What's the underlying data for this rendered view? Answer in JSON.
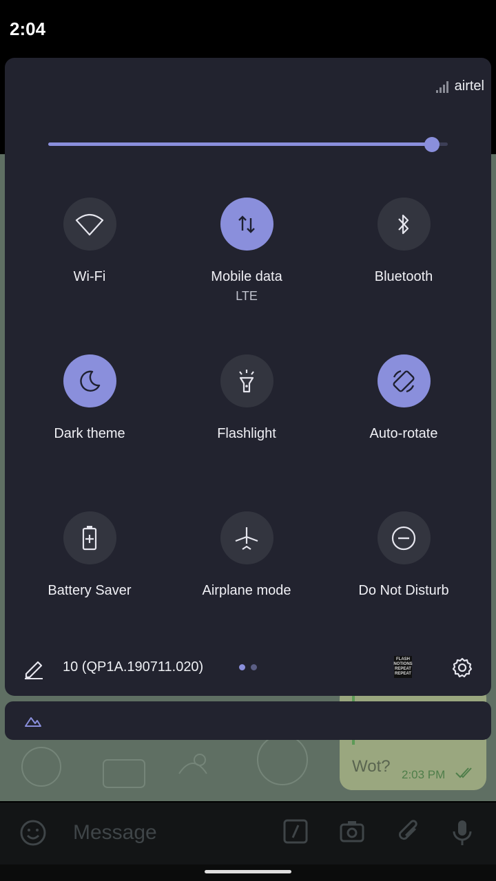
{
  "status_bar": {
    "time": "2:04"
  },
  "quick_settings": {
    "carrier": "airtel",
    "brightness": 0.96,
    "tiles": [
      {
        "label": "Wi-Fi",
        "sub": "",
        "active": false,
        "icon": "wifi-icon"
      },
      {
        "label": "Mobile data",
        "sub": "LTE",
        "active": true,
        "icon": "mobile-data-icon"
      },
      {
        "label": "Bluetooth",
        "sub": "",
        "active": false,
        "icon": "bluetooth-icon"
      },
      {
        "label": "Dark theme",
        "sub": "",
        "active": true,
        "icon": "moon-icon"
      },
      {
        "label": "Flashlight",
        "sub": "",
        "active": false,
        "icon": "flashlight-icon"
      },
      {
        "label": "Auto-rotate",
        "sub": "",
        "active": true,
        "icon": "rotate-icon"
      },
      {
        "label": "Battery Saver",
        "sub": "",
        "active": false,
        "icon": "battery-saver-icon"
      },
      {
        "label": "Airplane mode",
        "sub": "",
        "active": false,
        "icon": "airplane-icon"
      },
      {
        "label": "Do Not Disturb",
        "sub": "",
        "active": false,
        "icon": "do-not-disturb-icon"
      }
    ],
    "build": "10 (QP1A.190711.020)",
    "page_indicator": {
      "pages": 2,
      "current": 1
    },
    "flash_badge_lines": [
      "FLASH",
      "NOTIONS",
      "REPEAT",
      "REPEAT"
    ]
  },
  "background_chat": {
    "bubble_text": "Wot?",
    "bubble_time": "2:03 PM",
    "composer_placeholder": "Message"
  },
  "colors": {
    "accent": "#8a8fdc",
    "panel": "#22232f",
    "tile_off": "#33353f"
  }
}
